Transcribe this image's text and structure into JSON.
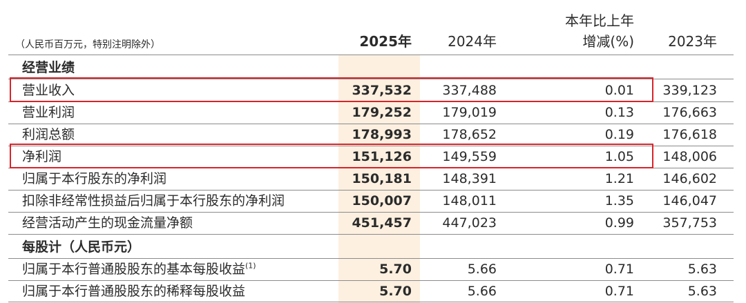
{
  "header": {
    "unit_note": "（人民币百万元，特别注明除外）",
    "col_2025": "2025年",
    "col_2024": "2024年",
    "col_change_line1": "本年比上年",
    "col_change_line2": "增减(%)",
    "col_2023": "2023年"
  },
  "sections": [
    {
      "title": "经营业绩",
      "rows": [
        {
          "label": "营业收入",
          "v2025": "337,532",
          "v2024": "337,488",
          "change": "0.01",
          "v2023": "339,123"
        },
        {
          "label": "营业利润",
          "v2025": "179,252",
          "v2024": "179,019",
          "change": "0.13",
          "v2023": "176,663"
        },
        {
          "label": "利润总额",
          "v2025": "178,993",
          "v2024": "178,652",
          "change": "0.19",
          "v2023": "176,618"
        },
        {
          "label": "净利润",
          "v2025": "151,126",
          "v2024": "149,559",
          "change": "1.05",
          "v2023": "148,006"
        },
        {
          "label": "归属于本行股东的净利润",
          "v2025": "150,181",
          "v2024": "148,391",
          "change": "1.21",
          "v2023": "146,602"
        },
        {
          "label": "扣除非经常性损益后归属于本行股东的净利润",
          "v2025": "150,007",
          "v2024": "148,011",
          "change": "1.35",
          "v2023": "146,047"
        },
        {
          "label": "经营活动产生的现金流量净额",
          "v2025": "451,457",
          "v2024": "447,023",
          "change": "0.99",
          "v2023": "357,753"
        }
      ]
    },
    {
      "title": "每股计（人民币元）",
      "rows": [
        {
          "label": "归属于本行普通股股东的基本每股收益",
          "note": "(1)",
          "v2025": "5.70",
          "v2024": "5.66",
          "change": "0.71",
          "v2023": "5.63"
        },
        {
          "label": "归属于本行普通股股东的稀释每股收益",
          "v2025": "5.70",
          "v2024": "5.66",
          "change": "0.71",
          "v2023": "5.63"
        }
      ]
    }
  ],
  "colors": {
    "highlight_column": "#fdf0e0",
    "highlight_box": "#d8232a",
    "rule": "#8a8a8a"
  }
}
